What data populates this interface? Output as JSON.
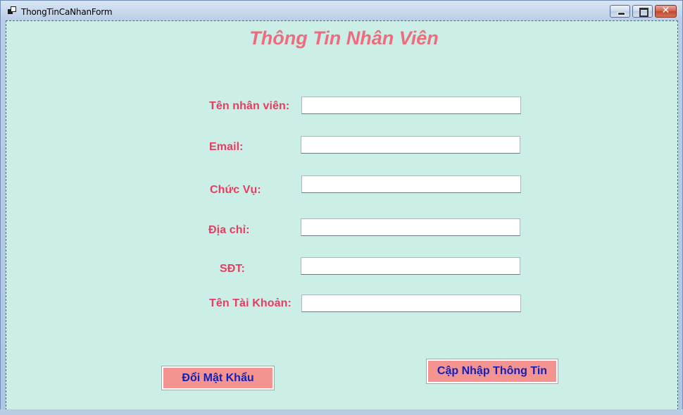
{
  "window": {
    "title": "ThongTinCaNhanForm",
    "controls": {
      "minimize": "minimize",
      "maximize": "maximize",
      "close": "✕"
    }
  },
  "form": {
    "heading": "Thông Tin Nhân Viên",
    "fields": [
      {
        "label": "Tên nhân viên:",
        "value": ""
      },
      {
        "label": "Email:",
        "value": ""
      },
      {
        "label": "Chức Vụ:",
        "value": ""
      },
      {
        "label": "Địa chỉ:",
        "value": ""
      },
      {
        "label": "SĐT:",
        "value": ""
      },
      {
        "label": "Tên Tài Khoản:",
        "value": ""
      }
    ],
    "buttons": {
      "change_password": "Đổi Mật Khẩu",
      "update_info": "Cập Nhập Thông Tin"
    }
  },
  "colors": {
    "background": "#cbeee6",
    "heading": "#ee6c7d",
    "label": "#e83d62",
    "button_bg": "#f39490",
    "button_text": "#1321b8"
  }
}
